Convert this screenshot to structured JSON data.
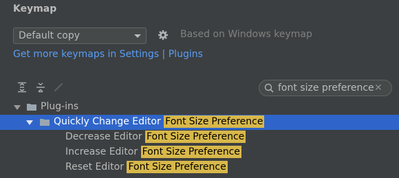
{
  "header": {
    "title": "Keymap"
  },
  "keymap": {
    "selected": "Default copy",
    "based_on": "Based on Windows keymap",
    "link_settings": "Get more keymaps in Settings",
    "link_sep": " | ",
    "link_plugins": "Plugins"
  },
  "toolbar": {
    "icons": [
      "expand-all-icon",
      "collapse-all-icon",
      "edit-shortcut-icon"
    ]
  },
  "search": {
    "value": "font size preference",
    "clear": "✕"
  },
  "tree": {
    "plugins": "Plug-ins",
    "group": {
      "label": "Quickly Change Editor",
      "hl": [
        "Font",
        "Size",
        "Preference"
      ]
    },
    "items": [
      {
        "label": "Decrease Editor",
        "hl": [
          "Font",
          "Size",
          "Preference"
        ]
      },
      {
        "label": "Increase Editor",
        "hl": [
          "Font",
          "Size",
          "Preference"
        ]
      },
      {
        "label": "Reset Editor",
        "hl": [
          "Font",
          "Size",
          "Preference"
        ]
      }
    ]
  },
  "colors": {
    "background": "#3c3f41",
    "selection": "#2f65ca",
    "link": "#589df6",
    "highlight": "#d8b84a"
  }
}
